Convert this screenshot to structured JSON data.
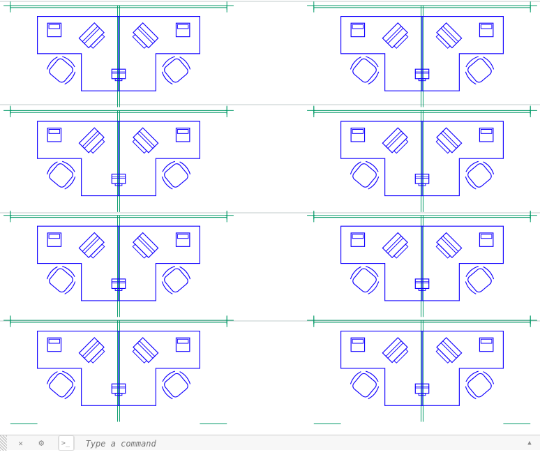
{
  "command_bar": {
    "placeholder": "Type a command",
    "prompt": ">_",
    "close_icon": "✕",
    "settings_icon": "⚙",
    "expand_icon": "▲"
  },
  "drawing": {
    "layer_desk": "#1100ff",
    "layer_partition": "#009966",
    "layer_boundary": "#335555",
    "rows": 4,
    "columns": 2,
    "workstations_total": 16
  }
}
